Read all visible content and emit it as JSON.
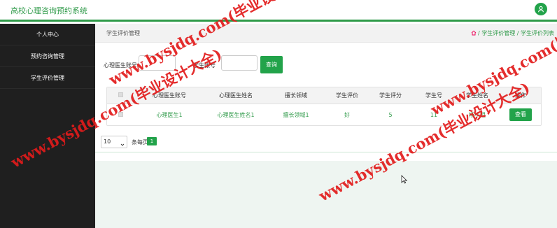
{
  "header": {
    "title": "高校心理咨询预约系统"
  },
  "sidebar": {
    "items": [
      {
        "label": "个人中心"
      },
      {
        "label": "预约咨询管理"
      },
      {
        "label": "学生评价管理"
      }
    ]
  },
  "breadcrumb": {
    "title": "学生评价管理",
    "trail": "/ 学生评价管理 / 学生评价列表"
  },
  "search": {
    "field1_label": "心理医生账号",
    "field2_label": "学生账号",
    "button_label": "查询"
  },
  "table": {
    "headers": [
      "心理医生账号",
      "心理医生姓名",
      "擅长领域",
      "学生评价",
      "学生评分",
      "学生号",
      "学生姓名",
      "操作"
    ],
    "rows": [
      {
        "doctor_account": "心理医生1",
        "doctor_name": "心理医生姓名1",
        "field": "擅长领域1",
        "evaluation": "好",
        "score": "5",
        "student_no": "11",
        "student_name": "杨小姐",
        "action": "查看"
      }
    ]
  },
  "pager": {
    "page_size": "10",
    "per_page_label": "条每页",
    "current_page": "1"
  },
  "watermark": {
    "text1": "www.bysjdq.com(毕业设计大全)",
    "text2": "www.bysjdq.com(毕业设计大全)"
  },
  "colors": {
    "accent": "#22a34a",
    "sidebar": "#1f1f1f",
    "watermark": "#e21b1b"
  }
}
